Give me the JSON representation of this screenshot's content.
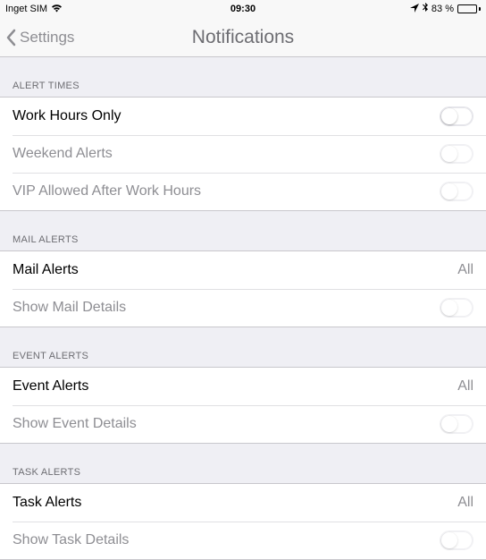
{
  "status": {
    "carrier": "Inget SIM",
    "time": "09:30",
    "battery_pct": "83 %"
  },
  "nav": {
    "back_label": "Settings",
    "title": "Notifications"
  },
  "sections": {
    "alert_times": {
      "header": "ALERT TIMES",
      "rows": {
        "work_hours": "Work Hours Only",
        "weekend": "Weekend Alerts",
        "vip": "VIP Allowed After Work Hours"
      }
    },
    "mail_alerts": {
      "header": "MAIL ALERTS",
      "rows": {
        "mail": "Mail Alerts",
        "mail_value": "All",
        "show_details": "Show Mail Details"
      }
    },
    "event_alerts": {
      "header": "EVENT ALERTS",
      "rows": {
        "event": "Event Alerts",
        "event_value": "All",
        "show_details": "Show Event Details"
      }
    },
    "task_alerts": {
      "header": "TASK ALERTS",
      "rows": {
        "task": "Task Alerts",
        "task_value": "All",
        "show_details": "Show Task Details"
      }
    }
  }
}
